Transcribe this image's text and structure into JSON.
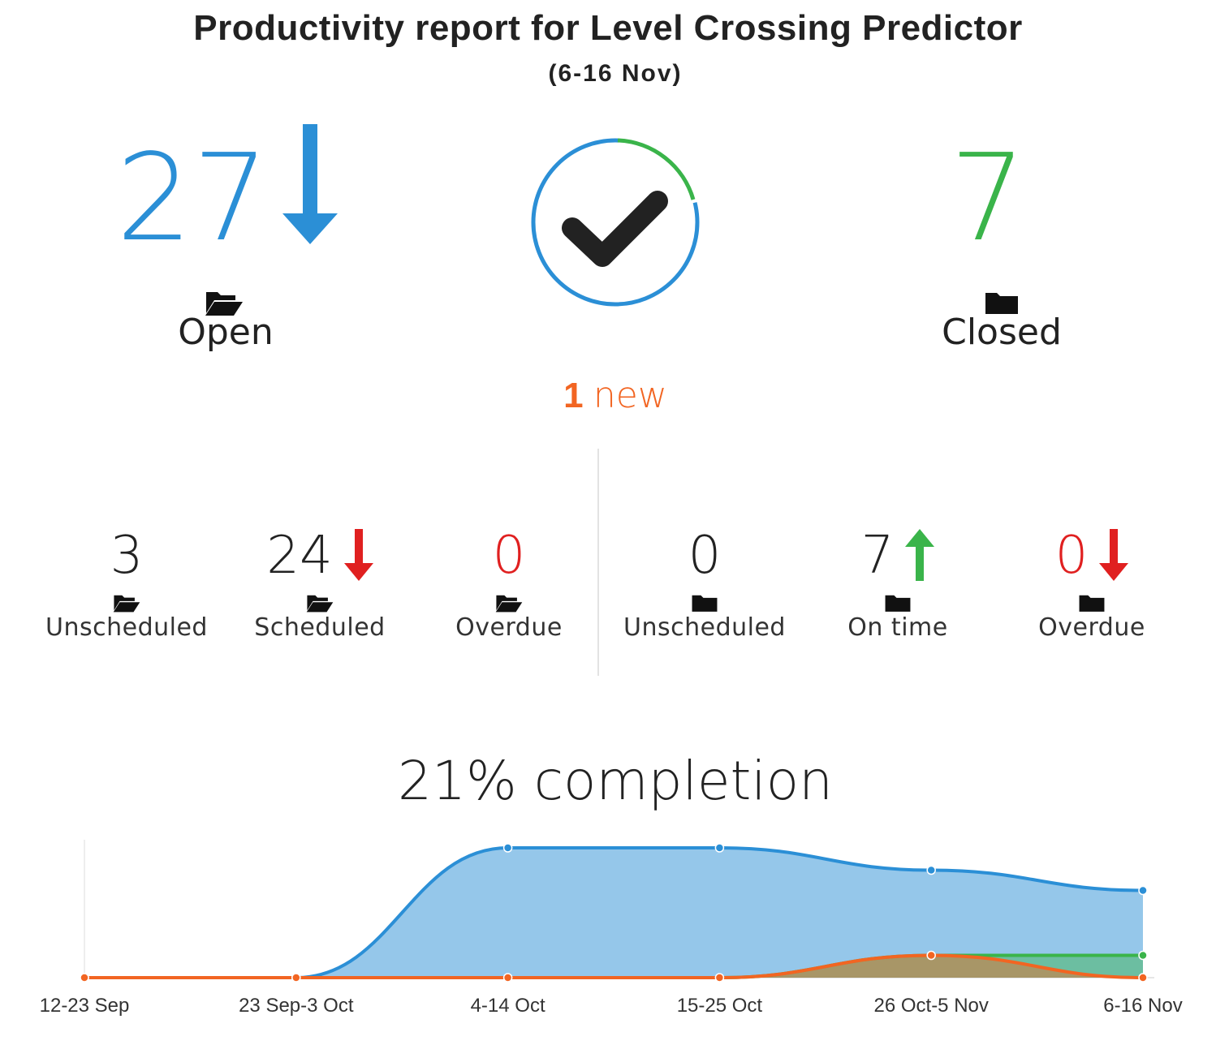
{
  "report": {
    "title": "Productivity report for Level Crossing Predictor",
    "period": "(6-16 Nov)"
  },
  "summary": {
    "open": {
      "count": "27",
      "label": "Open",
      "trend": "down",
      "icon": "folder-open-icon",
      "color": "#2b8fd6"
    },
    "closed": {
      "count": "7",
      "label": "Closed",
      "icon": "folder-icon",
      "color": "#3ab44a"
    },
    "center_icon": "check-circle-icon",
    "new_count": "1",
    "new_label": "new",
    "new_color": "#f26522"
  },
  "open_breakdown": [
    {
      "value": "3",
      "label": "Unscheduled",
      "icon": "folder-open-icon",
      "trend": null,
      "color": "#222222"
    },
    {
      "value": "24",
      "label": "Scheduled",
      "icon": "folder-open-icon",
      "trend": "down",
      "color": "#222222"
    },
    {
      "value": "0",
      "label": "Overdue",
      "icon": "folder-open-icon",
      "trend": null,
      "color": "#e02020"
    }
  ],
  "closed_breakdown": [
    {
      "value": "0",
      "label": "Unscheduled",
      "icon": "folder-icon",
      "trend": null,
      "color": "#222222"
    },
    {
      "value": "7",
      "label": "On time",
      "icon": "folder-icon",
      "trend": "up",
      "color": "#222222"
    },
    {
      "value": "0",
      "label": "Overdue",
      "icon": "folder-icon",
      "trend": "down",
      "color": "#e02020"
    }
  ],
  "completion": {
    "percent": 21,
    "label": "21% completion"
  },
  "chart_data": {
    "type": "area",
    "categories": [
      "12-23 Sep",
      "23 Sep-3 Oct",
      "4-14 Oct",
      "15-25 Oct",
      "26 Oct-5 Nov",
      "6-16 Nov"
    ],
    "series": [
      {
        "values": [
          0,
          0,
          32,
          32,
          26.5,
          21.5
        ],
        "color": "#2b8fd6"
      },
      {
        "values": [
          0,
          0,
          0,
          0,
          5.5,
          5.5
        ],
        "color": "#3ab44a"
      },
      {
        "values": [
          0,
          0,
          0,
          0,
          5.5,
          0
        ],
        "color": "#f26522"
      }
    ],
    "ylim": [
      0,
      34
    ],
    "grid": false,
    "legend": "none"
  }
}
